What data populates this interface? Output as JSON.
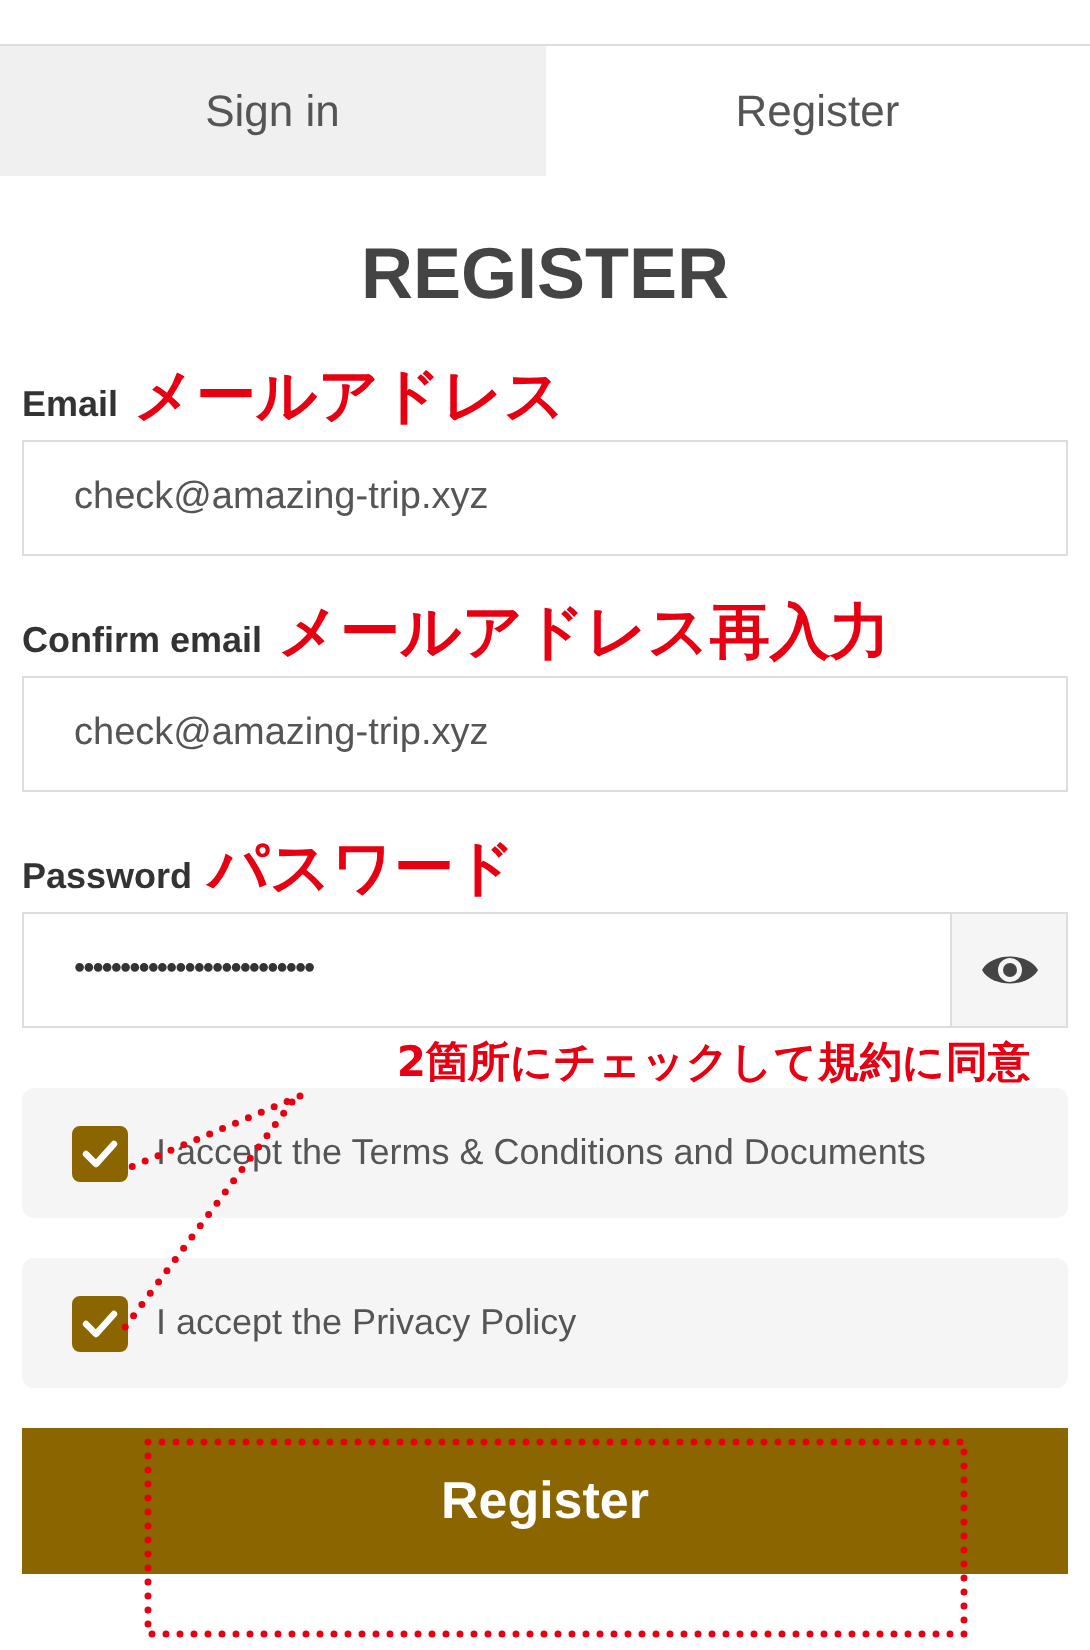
{
  "tabs": [
    {
      "label": "Sign in",
      "selected": false
    },
    {
      "label": "Register",
      "selected": true
    }
  ],
  "title": "REGISTER",
  "fields": [
    {
      "label": "Email",
      "note": "メールアドレス",
      "value": "check@amazing-trip.xyz",
      "kind": "text"
    },
    {
      "label": "Confirm email",
      "note": "メールアドレス再入力",
      "value": "check@amazing-trip.xyz",
      "kind": "text"
    },
    {
      "label": "Password",
      "note": "パスワード",
      "value": "••••••••••••••••••••••••••",
      "kind": "password"
    }
  ],
  "checkbox_note": "2箇所にチェックして規約に同意",
  "checkboxes": [
    {
      "label": "I accept the Terms & Conditions and Documents",
      "checked": true
    },
    {
      "label": "I accept the Privacy Policy",
      "checked": true
    }
  ],
  "submit_button": "Register"
}
